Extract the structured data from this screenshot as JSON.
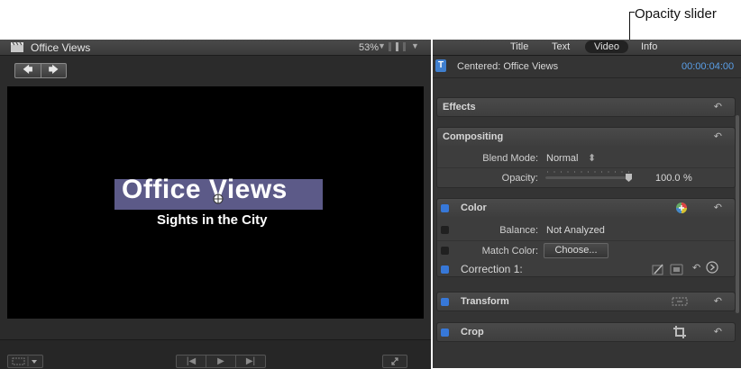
{
  "annotation": {
    "label": "Opacity slider"
  },
  "viewer": {
    "title": "Office Views",
    "zoom": "53%",
    "nav_back": "🡄",
    "nav_forward": "🡆",
    "title_text": "Office Views",
    "subtitle_text": "Sights in the City",
    "transport": {
      "prev": "|◀",
      "play": "▶",
      "next": "▶|"
    },
    "icons": [
      "clapperboard-icon",
      "view-options-icon",
      "transform-icon",
      "fullscreen-icon",
      "center-target-icon"
    ]
  },
  "inspector": {
    "tabs": [
      "Title",
      "Text",
      "Video",
      "Info"
    ],
    "active_tab": "Video",
    "clip_icon": "T",
    "clip_name": "Centered: Office Views",
    "timecode": "00:00:04:00",
    "effects": {
      "title": "Effects"
    },
    "compositing": {
      "title": "Compositing",
      "blend_label": "Blend Mode:",
      "blend_value": "Normal",
      "blend_arrows": "⬍",
      "opacity_label": "Opacity:",
      "opacity_value": "100.0",
      "opacity_unit": "%",
      "opacity_fraction": 1.0
    },
    "color": {
      "title": "Color",
      "balance_label": "Balance:",
      "balance_value": "Not Analyzed",
      "match_label": "Match Color:",
      "match_button": "Choose...",
      "correction_label": "Correction 1:"
    },
    "transform": {
      "title": "Transform"
    },
    "crop": {
      "title": "Crop"
    },
    "reset_glyph": "↶",
    "colors": {
      "accent_blue": "#3778d8",
      "timecode_blue": "#5a9fe8",
      "title_highlight": "#5c5a88"
    }
  }
}
